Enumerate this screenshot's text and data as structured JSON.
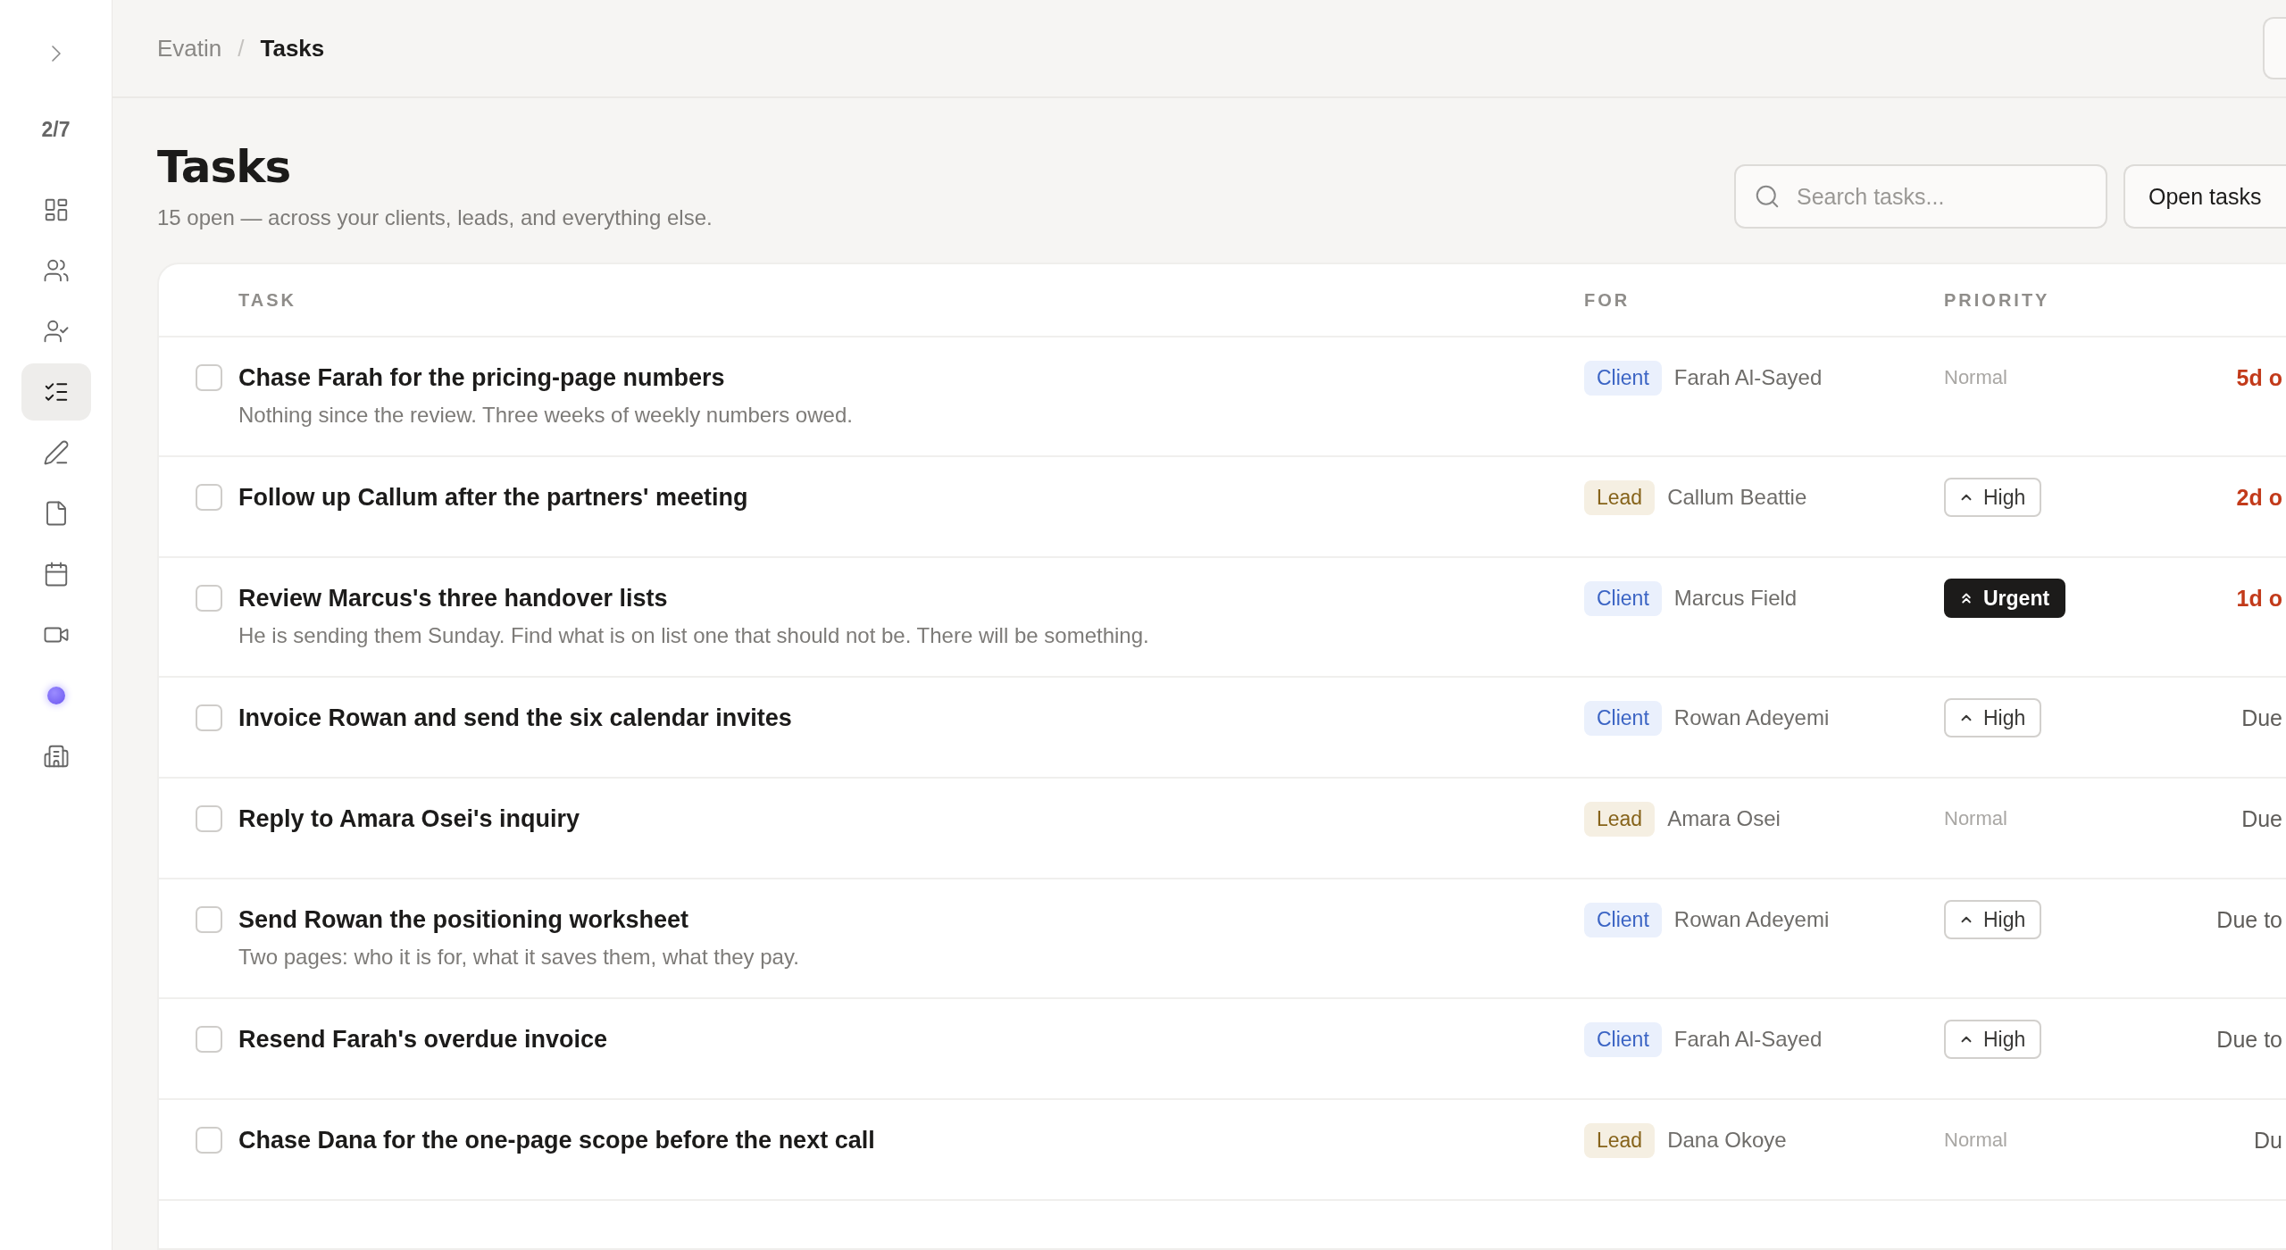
{
  "sidebar": {
    "pager": "2/7",
    "items": [
      {
        "selected": false
      },
      {
        "selected": false
      },
      {
        "selected": false
      },
      {
        "selected": true
      },
      {
        "selected": false
      },
      {
        "selected": false
      },
      {
        "selected": false
      },
      {
        "selected": false
      },
      {
        "selected": false
      },
      {
        "selected": false
      }
    ]
  },
  "breadcrumb": [
    "Evatin",
    "Tasks"
  ],
  "breadcrumb_separator": "/",
  "page": {
    "title": "Tasks",
    "subtitle": "15 open — across your clients, leads, and everything else."
  },
  "search": {
    "placeholder": "Search tasks..."
  },
  "filter": {
    "label": "Open tasks"
  },
  "table": {
    "columns": [
      "TASK",
      "FOR",
      "PRIORITY"
    ],
    "rows": [
      {
        "checked": false,
        "title": "Chase Farah for the pricing-page numbers",
        "note": "Nothing since the review. Three weeks of weekly numbers owed.",
        "for": {
          "kind": "client",
          "tag": "Client",
          "name": "Farah Al-Sayed"
        },
        "priority": {
          "kind": "normal",
          "label": "Normal"
        },
        "due": {
          "text": "5d o",
          "overdue": true
        }
      },
      {
        "checked": false,
        "title": "Follow up Callum after the partners' meeting",
        "for": {
          "kind": "lead",
          "tag": "Lead",
          "name": "Callum Beattie"
        },
        "priority": {
          "kind": "high",
          "label": "High"
        },
        "due": {
          "text": "2d o",
          "overdue": true
        }
      },
      {
        "checked": false,
        "title": "Review Marcus's three handover lists",
        "note": "He is sending them Sunday. Find what is on list one that should not be. There will be something.",
        "for": {
          "kind": "client",
          "tag": "Client",
          "name": "Marcus Field"
        },
        "priority": {
          "kind": "urgent",
          "label": "Urgent"
        },
        "due": {
          "text": "1d o",
          "overdue": true
        }
      },
      {
        "checked": false,
        "title": "Invoice Rowan and send the six calendar invites",
        "for": {
          "kind": "client",
          "tag": "Client",
          "name": "Rowan Adeyemi"
        },
        "priority": {
          "kind": "high",
          "label": "High"
        },
        "due": {
          "text": "Due",
          "overdue": false
        }
      },
      {
        "checked": false,
        "title": "Reply to Amara Osei's inquiry",
        "for": {
          "kind": "lead",
          "tag": "Lead",
          "name": "Amara Osei"
        },
        "priority": {
          "kind": "normal",
          "label": "Normal"
        },
        "due": {
          "text": "Due",
          "overdue": false
        }
      },
      {
        "checked": false,
        "title": "Send Rowan the positioning worksheet",
        "note": "Two pages: who it is for, what it saves them, what they pay.",
        "for": {
          "kind": "client",
          "tag": "Client",
          "name": "Rowan Adeyemi"
        },
        "priority": {
          "kind": "high",
          "label": "High"
        },
        "due": {
          "text": "Due to",
          "overdue": false
        }
      },
      {
        "checked": false,
        "title": "Resend Farah's overdue invoice",
        "for": {
          "kind": "client",
          "tag": "Client",
          "name": "Farah Al-Sayed"
        },
        "priority": {
          "kind": "high",
          "label": "High"
        },
        "due": {
          "text": "Due to",
          "overdue": false
        }
      },
      {
        "checked": false,
        "title": "Chase Dana for the one-page scope before the next call",
        "for": {
          "kind": "lead",
          "tag": "Lead",
          "name": "Dana Okoye"
        },
        "priority": {
          "kind": "normal",
          "label": "Normal"
        },
        "due": {
          "text": "Du",
          "overdue": false
        }
      }
    ]
  }
}
